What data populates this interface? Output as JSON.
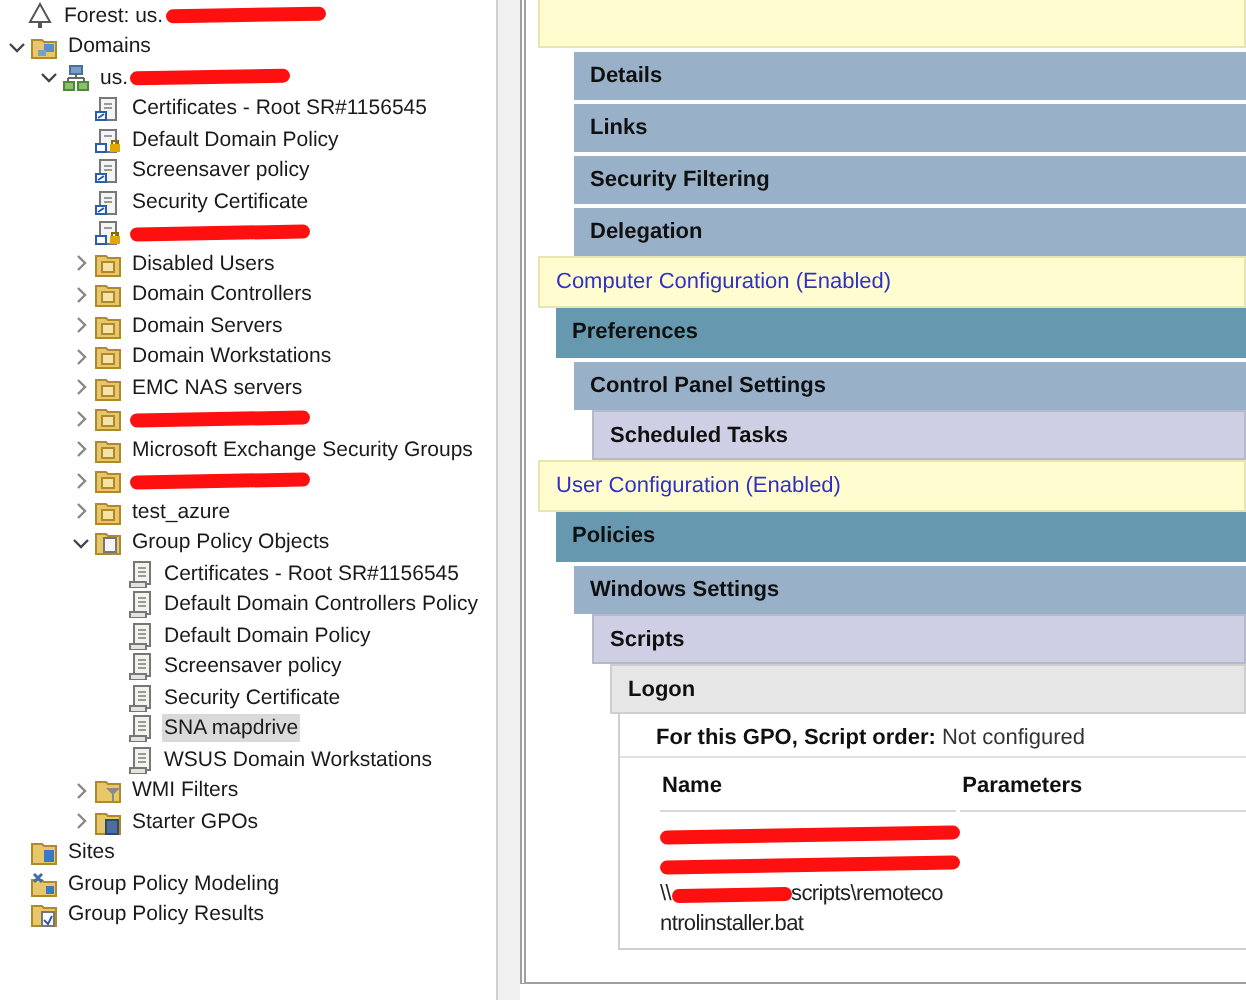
{
  "tree": [
    {
      "label": "Forest: us.",
      "kind": "forest",
      "redacted": true,
      "selected": false,
      "children": [
        {
          "label": "Domains",
          "kind": "domains",
          "expanded": true,
          "selected": false,
          "children": [
            {
              "label": "us.",
              "kind": "domain",
              "expanded": true,
              "redacted": true,
              "selected": false,
              "children": [
                {
                  "label": "Certificates - Root SR#1156545",
                  "kind": "gpo-link",
                  "selected": false
                },
                {
                  "label": "Default Domain Policy",
                  "kind": "gpo-link-enforced",
                  "selected": false
                },
                {
                  "label": "Screensaver policy",
                  "kind": "gpo-link",
                  "selected": false
                },
                {
                  "label": "Security Certificate",
                  "kind": "gpo-link",
                  "selected": false
                },
                {
                  "kind": "gpo-link-enforced",
                  "redacted": true,
                  "selected": false
                },
                {
                  "label": "Disabled Users",
                  "kind": "ou",
                  "expanded": false,
                  "selected": false
                },
                {
                  "label": "Domain Controllers",
                  "kind": "ou",
                  "expanded": false,
                  "selected": false
                },
                {
                  "label": "Domain Servers",
                  "kind": "ou",
                  "expanded": false,
                  "selected": false
                },
                {
                  "label": "Domain Workstations",
                  "kind": "ou",
                  "expanded": false,
                  "selected": false
                },
                {
                  "label": "EMC NAS servers",
                  "kind": "ou",
                  "expanded": false,
                  "selected": false
                },
                {
                  "kind": "ou",
                  "expanded": false,
                  "redacted": true,
                  "selected": false
                },
                {
                  "label": "Microsoft Exchange Security Groups",
                  "kind": "ou",
                  "expanded": false,
                  "selected": false
                },
                {
                  "kind": "ou",
                  "expanded": false,
                  "redacted": true,
                  "selected": false
                },
                {
                  "label": "test_azure",
                  "kind": "ou",
                  "expanded": false,
                  "selected": false
                },
                {
                  "label": "Group Policy Objects",
                  "kind": "gpo-container",
                  "expanded": true,
                  "selected": false,
                  "children": [
                    {
                      "label": "Certificates - Root SR#1156545",
                      "kind": "gpo",
                      "selected": false
                    },
                    {
                      "label": "Default Domain Controllers Policy",
                      "kind": "gpo",
                      "selected": false
                    },
                    {
                      "label": "Default Domain Policy",
                      "kind": "gpo",
                      "selected": false
                    },
                    {
                      "label": "Screensaver policy",
                      "kind": "gpo",
                      "selected": false
                    },
                    {
                      "label": "Security Certificate",
                      "kind": "gpo",
                      "selected": false
                    },
                    {
                      "label": "SNA mapdrive",
                      "kind": "gpo",
                      "selected": true
                    },
                    {
                      "label": "WSUS Domain Workstations",
                      "kind": "gpo",
                      "selected": false
                    }
                  ]
                },
                {
                  "label": "WMI Filters",
                  "kind": "wmi-container",
                  "expanded": false,
                  "selected": false
                },
                {
                  "label": "Starter GPOs",
                  "kind": "starter-container",
                  "expanded": false,
                  "selected": false
                }
              ]
            }
          ]
        },
        {
          "label": "Sites",
          "kind": "sites",
          "selected": false
        },
        {
          "label": "Group Policy Modeling",
          "kind": "modeling",
          "selected": false
        },
        {
          "label": "Group Policy Results",
          "kind": "results",
          "selected": false
        }
      ]
    }
  ],
  "report": [
    {
      "kind": "config",
      "children": [
        {
          "label": "Details",
          "kind": "subcategory"
        },
        {
          "label": "Links",
          "kind": "subcategory"
        },
        {
          "label": "Security Filtering",
          "kind": "subcategory"
        },
        {
          "label": "Delegation",
          "kind": "subcategory"
        }
      ]
    },
    {
      "label": "Computer Configuration (Enabled)",
      "kind": "config",
      "children": [
        {
          "label": "Preferences",
          "kind": "category",
          "children": [
            {
              "label": "Control Panel Settings",
              "kind": "subcategory",
              "children": [
                {
                  "label": "Scheduled Tasks",
                  "kind": "extension"
                }
              ]
            }
          ]
        }
      ]
    },
    {
      "label": "User Configuration (Enabled)",
      "kind": "config",
      "children": [
        {
          "label": "Policies",
          "kind": "category",
          "children": [
            {
              "label": "Windows Settings",
              "kind": "subcategory",
              "children": [
                {
                  "label": "Scripts",
                  "kind": "extension",
                  "children": [
                    {
                      "label": "Logon",
                      "kind": "item",
                      "content": {
                        "setting_label": "For this GPO, Script order:",
                        "setting_value": "Not configured",
                        "columns": [
                          "Name",
                          "Parameters"
                        ],
                        "rows": [
                          {
                            "name_lines": [
                              [
                                {
                                  "kind": "redaction"
                                }
                              ],
                              [
                                {
                                  "kind": "redaction"
                                }
                              ],
                              [
                                {
                                  "kind": "text",
                                  "text": "\\\\"
                                },
                                {
                                  "kind": "redaction"
                                },
                                {
                                  "kind": "text",
                                  "text": "scripts\\remoteco"
                                }
                              ],
                              [
                                {
                                  "kind": "text",
                                  "text": "ntrolinstaller.bat"
                                }
                              ]
                            ]
                          }
                        ]
                      }
                    }
                  ]
                }
              ]
            }
          ]
        }
      ]
    }
  ]
}
